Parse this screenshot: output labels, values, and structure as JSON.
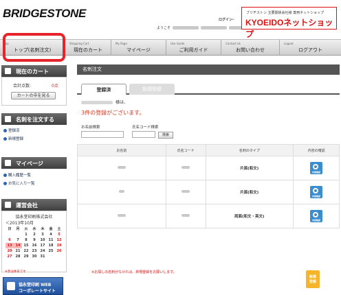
{
  "header": {
    "logo": "BRIDGESTONE",
    "login": "ログインｰ",
    "greeting": "ようこそ",
    "shop_sub": "ブリヂストン 主要関係会社様 専用ネットショップ",
    "shop_title": "KYOEIDOネットショップ"
  },
  "nav": [
    {
      "en": "Top",
      "jp": "トップ(名刺注文)"
    },
    {
      "en": "Shopping Cart",
      "jp": "現在のカート"
    },
    {
      "en": "My Page",
      "jp": "マイページ"
    },
    {
      "en": "Use Guide",
      "jp": "ご利用ガイド"
    },
    {
      "en": "Contact Us",
      "jp": "お問い合わせ"
    },
    {
      "en": "Logout",
      "jp": "ログアウト"
    }
  ],
  "sidebar": {
    "cart": {
      "title": "現在のカート",
      "total_label": "合計点数:",
      "total_value": "0点",
      "view_button": "カートの中を見る"
    },
    "order": {
      "title": "名刺を注文する",
      "links": [
        "登録済",
        "新規登録"
      ]
    },
    "mypage": {
      "title": "マイページ",
      "links": [
        "購入履歴一覧",
        "お気に入り一覧"
      ]
    },
    "company": {
      "title": "運営会社",
      "name": "協永堂印刷株式会社",
      "month": "＜2013年10月"
    },
    "calendar": {
      "weekdays": [
        "日",
        "月",
        "火",
        "水",
        "木",
        "金",
        "土"
      ],
      "rows": [
        [
          "",
          "",
          "1",
          "2",
          "3",
          "4",
          "5"
        ],
        [
          "6",
          "7",
          "8",
          "9",
          "10",
          "11",
          "12"
        ],
        [
          "13",
          "14",
          "15",
          "16",
          "17",
          "18",
          "19"
        ],
        [
          "20",
          "21",
          "22",
          "23",
          "24",
          "25",
          "26"
        ],
        [
          "27",
          "28",
          "29",
          "30",
          "31",
          "",
          ""
        ]
      ],
      "note": "※赤は休日です"
    },
    "corp_button": {
      "line1": "協永堂印刷 WEB",
      "line2": "コーポレートサイト"
    }
  },
  "main": {
    "title": "名刺注文",
    "tabs": [
      "登録済",
      "新規登録"
    ],
    "user_suffix": "様は、",
    "count_text": "3件の登録がございます。",
    "search": {
      "name_label": "お名前検索",
      "code_label": "氏名コード検索",
      "button": "検索"
    },
    "table": {
      "headers": [
        "お名前",
        "氏名コード",
        "名刺のタイプ",
        "内容の確認"
      ],
      "rows": [
        {
          "type": "片面(和文)",
          "check": "内容確認"
        },
        {
          "type": "片面(和文)",
          "check": "内容確認"
        },
        {
          "type": "両面(和文・英文)",
          "check": "内容確認"
        }
      ]
    },
    "footnote": "※お探しの名刺がなければ、新規登録をお願いします。",
    "new_button": [
      "新規",
      "登録"
    ]
  }
}
